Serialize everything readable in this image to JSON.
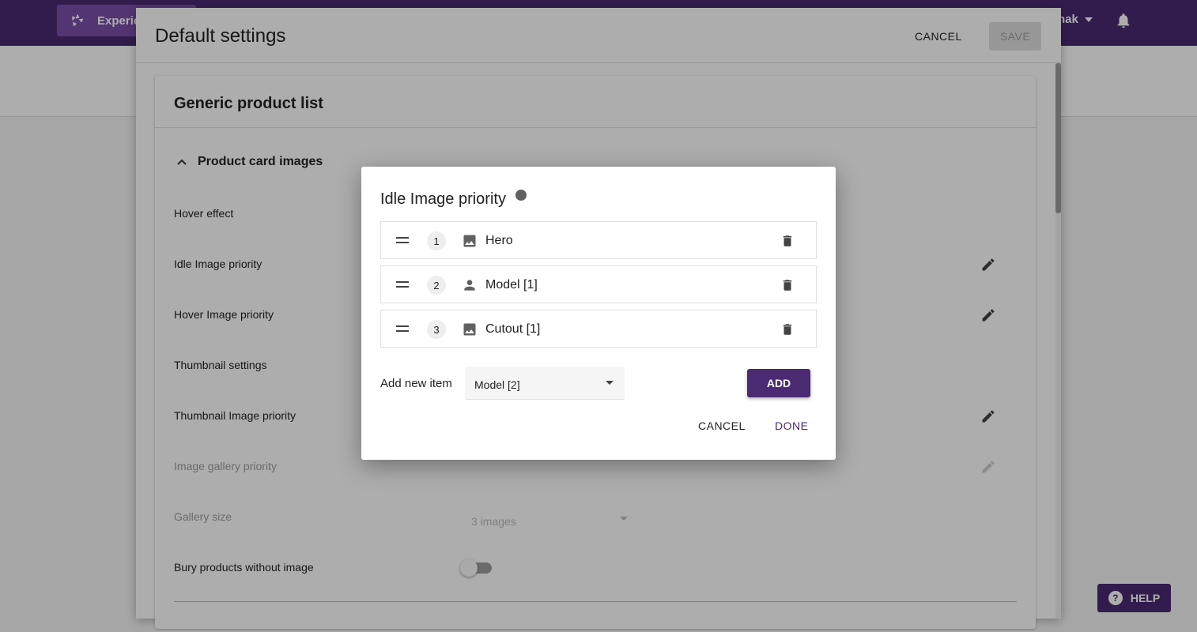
{
  "topbar": {
    "brand_label": "Experie",
    "user_label": "hak"
  },
  "panel": {
    "title": "Default settings",
    "cancel_label": "CANCEL",
    "save_label": "SAVE",
    "card_title": "Generic product list",
    "section_title": "Product card images",
    "rows": [
      {
        "label": "Hover effect"
      },
      {
        "label": "Idle Image priority"
      },
      {
        "label": "Hover Image priority"
      },
      {
        "label": "Thumbnail settings"
      },
      {
        "label": "Thumbnail Image priority"
      },
      {
        "label": "Image gallery priority"
      },
      {
        "label": "Gallery size"
      },
      {
        "label": "Bury products without image"
      }
    ],
    "gallery_size_value": "3 images",
    "bury_toggle_on": false
  },
  "help": {
    "label": "HELP"
  },
  "dialog": {
    "title": "Idle Image priority",
    "items": [
      {
        "number": "1",
        "icon": "image-icon",
        "label": "Hero"
      },
      {
        "number": "2",
        "icon": "person-icon",
        "label": "Model [1]"
      },
      {
        "number": "3",
        "icon": "image-icon",
        "label": "Cutout [1]"
      }
    ],
    "add_label": "Add new item",
    "add_select_value": "Model [2]",
    "add_button_label": "ADD",
    "cancel_label": "CANCEL",
    "done_label": "DONE"
  },
  "colors": {
    "brand": "#4a2a73",
    "brand_light": "#7a4fa8"
  }
}
